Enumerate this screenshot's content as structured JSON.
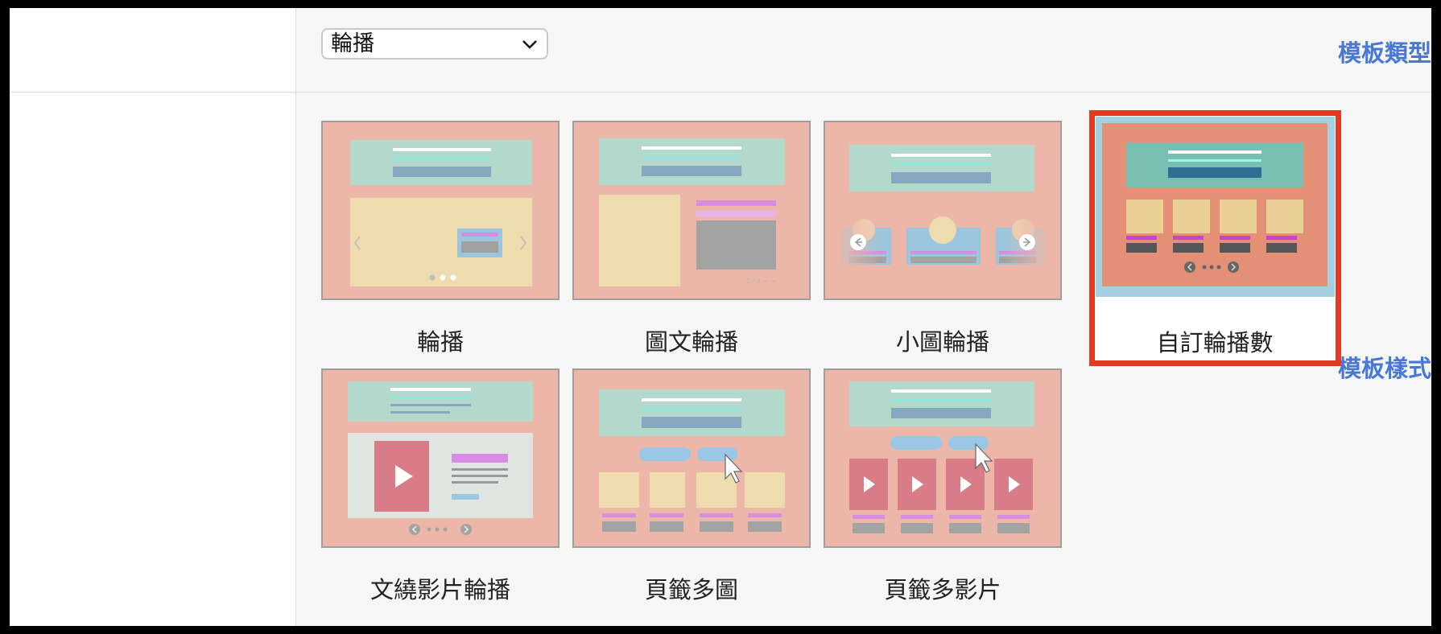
{
  "form": {
    "template_type": {
      "label": "模板類型",
      "selected_value": "輪播"
    },
    "template_style": {
      "label": "模板樣式",
      "options": [
        {
          "name": "輪播",
          "selected": false
        },
        {
          "name": "圖文輪播",
          "selected": false
        },
        {
          "name": "小圖輪播",
          "selected": false
        },
        {
          "name": "自訂輪播數",
          "selected": true
        },
        {
          "name": "文繞影片輪播",
          "selected": false
        },
        {
          "name": "頁籤多圖",
          "selected": false
        },
        {
          "name": "頁籤多影片",
          "selected": false
        }
      ]
    }
  },
  "colors": {
    "label_text": "#4778d6",
    "selected_border": "#e33a26",
    "thumb_background": "#ecb7a9"
  }
}
